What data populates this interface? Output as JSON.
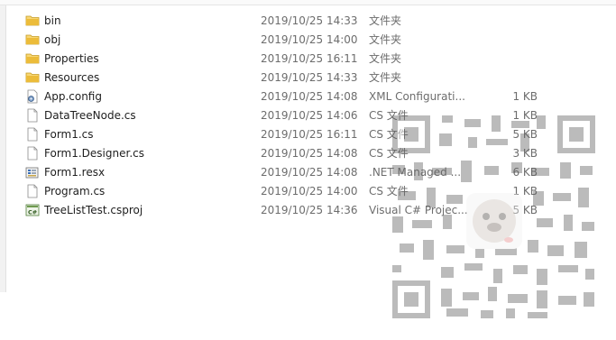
{
  "files": [
    {
      "name": "bin",
      "date": "2019/10/25 14:33",
      "type": "文件夹",
      "size": "",
      "icon": "folder-icon"
    },
    {
      "name": "obj",
      "date": "2019/10/25 14:00",
      "type": "文件夹",
      "size": "",
      "icon": "folder-icon"
    },
    {
      "name": "Properties",
      "date": "2019/10/25 16:11",
      "type": "文件夹",
      "size": "",
      "icon": "folder-icon"
    },
    {
      "name": "Resources",
      "date": "2019/10/25 14:33",
      "type": "文件夹",
      "size": "",
      "icon": "folder-icon"
    },
    {
      "name": "App.config",
      "date": "2019/10/25 14:08",
      "type": "XML Configurati...",
      "size": "1 KB",
      "icon": "config-file-icon"
    },
    {
      "name": "DataTreeNode.cs",
      "date": "2019/10/25 14:06",
      "type": "CS 文件",
      "size": "1 KB",
      "icon": "document-icon"
    },
    {
      "name": "Form1.cs",
      "date": "2019/10/25 16:11",
      "type": "CS 文件",
      "size": "5 KB",
      "icon": "document-icon"
    },
    {
      "name": "Form1.Designer.cs",
      "date": "2019/10/25 14:08",
      "type": "CS 文件",
      "size": "3 KB",
      "icon": "document-icon"
    },
    {
      "name": "Form1.resx",
      "date": "2019/10/25 14:08",
      "type": ".NET Managed ...",
      "size": "6 KB",
      "icon": "resx-file-icon"
    },
    {
      "name": "Program.cs",
      "date": "2019/10/25 14:00",
      "type": "CS 文件",
      "size": "1 KB",
      "icon": "document-icon"
    },
    {
      "name": "TreeListTest.csproj",
      "date": "2019/10/25 14:36",
      "type": "Visual C# Projec...",
      "size": "5 KB",
      "icon": "csproj-file-icon"
    }
  ],
  "colors": {
    "folder": "#e8b830",
    "text": "#1e1e1e",
    "detail_text": "#6d6d6d"
  }
}
